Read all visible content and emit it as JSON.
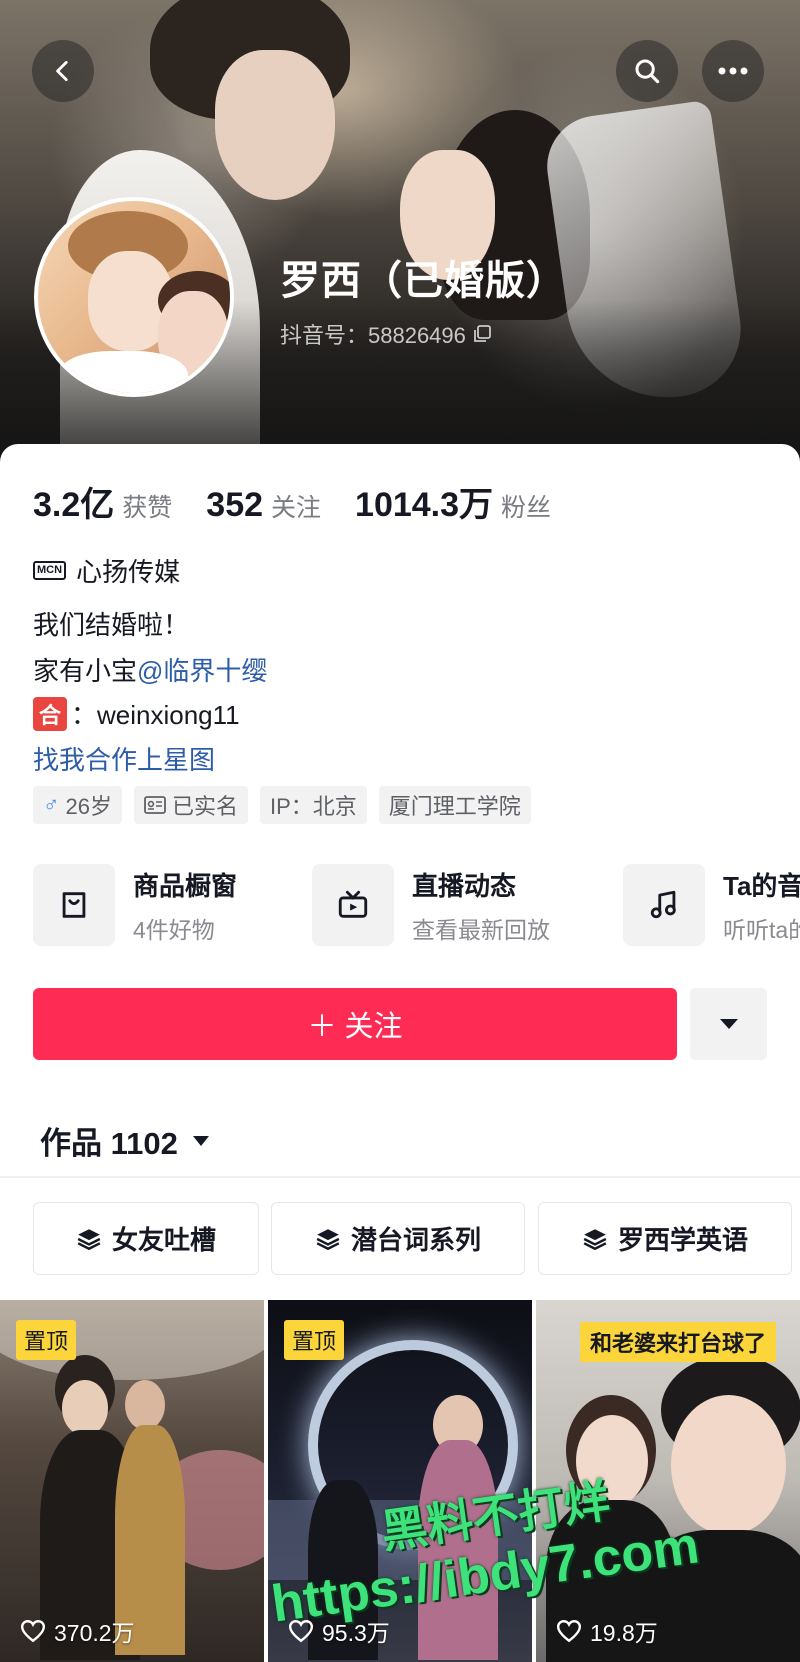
{
  "header": {
    "back_icon": "chevron-left-icon",
    "search_icon": "search-icon",
    "more_icon": "more-horizontal-icon"
  },
  "profile": {
    "nickname": "罗西（已婚版）",
    "douyin_id_label": "抖音号：58826496",
    "copy_icon": "copy-icon"
  },
  "stats": [
    {
      "value": "3.2亿",
      "label": "获赞"
    },
    {
      "value": "352",
      "label": "关注"
    },
    {
      "value": "1014.3万",
      "label": "粉丝"
    }
  ],
  "mcn": {
    "badge": "MCN",
    "name": "心扬传媒"
  },
  "bio": {
    "line1": "我们结婚啦！",
    "line2_prefix": "家有小宝",
    "line2_mention": "@临界十缨",
    "line3_badge": "合",
    "line3_text": "：weinxiong11",
    "line4_link": "找我合作上星图"
  },
  "tags": [
    {
      "icon": "male-icon",
      "label": "26岁"
    },
    {
      "icon": "id-card-icon",
      "label": "已实名"
    },
    {
      "label": "IP：北京"
    },
    {
      "label": "厦门理工学院"
    }
  ],
  "services": [
    {
      "icon": "shopping-bag-icon",
      "title": "商品橱窗",
      "subtitle": "4件好物"
    },
    {
      "icon": "tv-icon",
      "title": "直播动态",
      "subtitle": "查看最新回放"
    },
    {
      "icon": "music-note-icon",
      "title": "Ta的音",
      "subtitle": "听听ta的"
    }
  ],
  "follow_button": {
    "label": "＋ 关注"
  },
  "works_tab": {
    "label": "作品 1102"
  },
  "collections": [
    {
      "icon": "layers-icon",
      "label": "女友吐槽"
    },
    {
      "icon": "layers-icon",
      "label": "潜台词系列"
    },
    {
      "icon": "layers-icon",
      "label": "罗西学英语"
    }
  ],
  "videos": [
    {
      "pinned": "置顶",
      "likes": "370.2万"
    },
    {
      "pinned": "置顶",
      "likes": "95.3万"
    },
    {
      "caption": "和老婆来打台球了",
      "likes": "19.8万"
    }
  ],
  "watermark": {
    "line1": "黑料不打烊",
    "line2": "https://ibdy7.com"
  },
  "colors": {
    "accent": "#fe2c55",
    "link": "#2d5da8",
    "pin": "#fbd53a"
  }
}
